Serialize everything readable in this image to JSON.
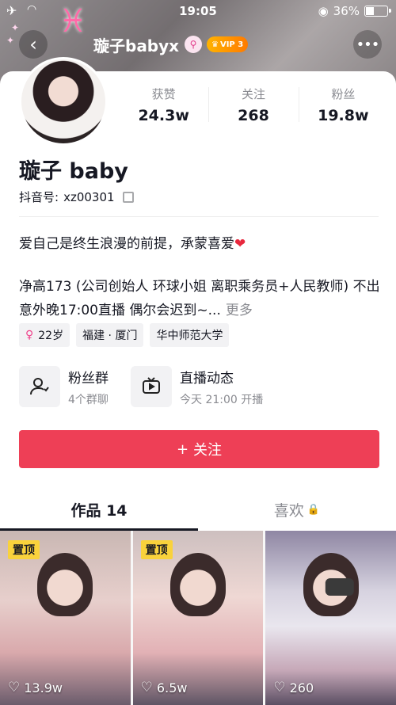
{
  "status_bar": {
    "time": "19:05",
    "battery": "36%"
  },
  "header": {
    "username": "璇子babyx",
    "vip_label": "VIP 3"
  },
  "stats": [
    {
      "label": "获赞",
      "value": "24.3w"
    },
    {
      "label": "关注",
      "value": "268"
    },
    {
      "label": "粉丝",
      "value": "19.8w"
    }
  ],
  "profile": {
    "display_name": "璇子 baby",
    "douyin_id_label": "抖音号:",
    "douyin_id": "xz00301",
    "bio_line1": "爱自己是终生浪漫的前提，承蒙喜爱",
    "bio_line2": "净高173 (公司创始人 环球小姐 离职乘务员+人民教师) 不出意外晚17:00直播 偶尔会迟到~...",
    "more_label": "更多"
  },
  "tags": [
    {
      "label": "22岁"
    },
    {
      "label": "福建 · 厦门"
    },
    {
      "label": "华中师范大学"
    }
  ],
  "entries": [
    {
      "title": "粉丝群",
      "subtitle": "4个群聊"
    },
    {
      "title": "直播动态",
      "subtitle": "今天 21:00 开播"
    }
  ],
  "follow_button": {
    "label": "关注"
  },
  "tabs": [
    {
      "label": "作品 14"
    },
    {
      "label": "喜欢"
    }
  ],
  "videos": [
    {
      "pinned_label": "置顶",
      "likes": "13.9w"
    },
    {
      "pinned_label": "置顶",
      "likes": "6.5w"
    },
    {
      "likes": "260"
    }
  ],
  "colors": {
    "accent": "#ee3f56",
    "pin": "#f9d23c",
    "heart": "#e8283d"
  }
}
